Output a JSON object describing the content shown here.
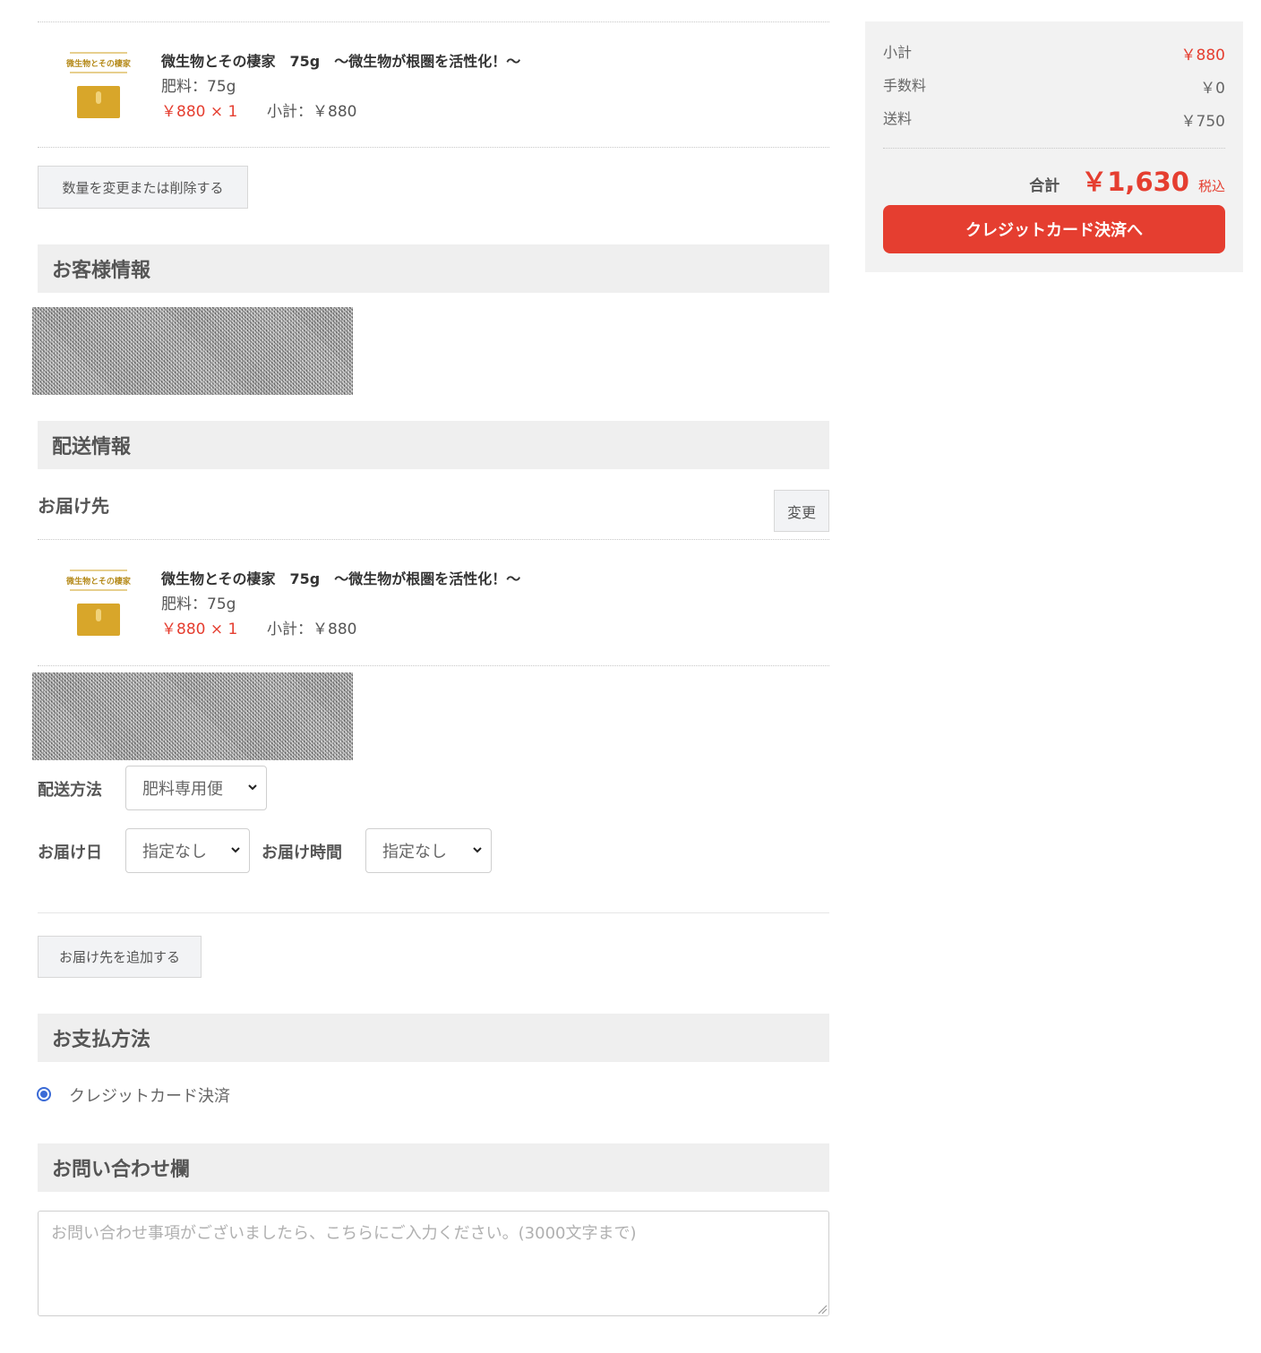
{
  "cart": {
    "item": {
      "name": "微生物とその棲家　75g　～微生物が根圏を活性化！～",
      "variant": "肥料：75g",
      "price_qty": "￥880 × 1",
      "subtotal": "小計：￥880",
      "thumb_text": "微生物とその棲家"
    },
    "change_qty_button": "数量を変更または削除する"
  },
  "customer": {
    "heading": "お客様情報"
  },
  "shipping": {
    "heading": "配送情報",
    "destination_title": "お届け先",
    "change_button": "変更",
    "item": {
      "name": "微生物とその棲家　75g　～微生物が根圏を活性化！～",
      "variant": "肥料：75g",
      "price_qty": "￥880 × 1",
      "subtotal": "小計：￥880",
      "thumb_text": "微生物とその棲家"
    },
    "method_label": "配送方法",
    "method_value": "肥料専用便",
    "date_label": "お届け日",
    "date_value": "指定なし",
    "time_label": "お届け時間",
    "time_value": "指定なし",
    "add_destination_button": "お届け先を追加する"
  },
  "payment": {
    "heading": "お支払方法",
    "option": "クレジットカード決済",
    "selected": true
  },
  "inquiry": {
    "heading": "お問い合わせ欄",
    "placeholder": "お問い合わせ事項がございましたら、こちらにご入力ください。(3000文字まで)"
  },
  "summary": {
    "subtotal_label": "小計",
    "subtotal_value": "￥880",
    "fee_label": "手数料",
    "fee_value": "￥0",
    "shipping_label": "送料",
    "shipping_value": "￥750",
    "total_label": "合計",
    "total_value": "￥1,630",
    "tax_note": "税込",
    "checkout_button": "クレジットカード決済へ"
  },
  "colors": {
    "accent": "#e53e30",
    "section_bg": "#efefef",
    "radio": "#3b6bd6"
  }
}
